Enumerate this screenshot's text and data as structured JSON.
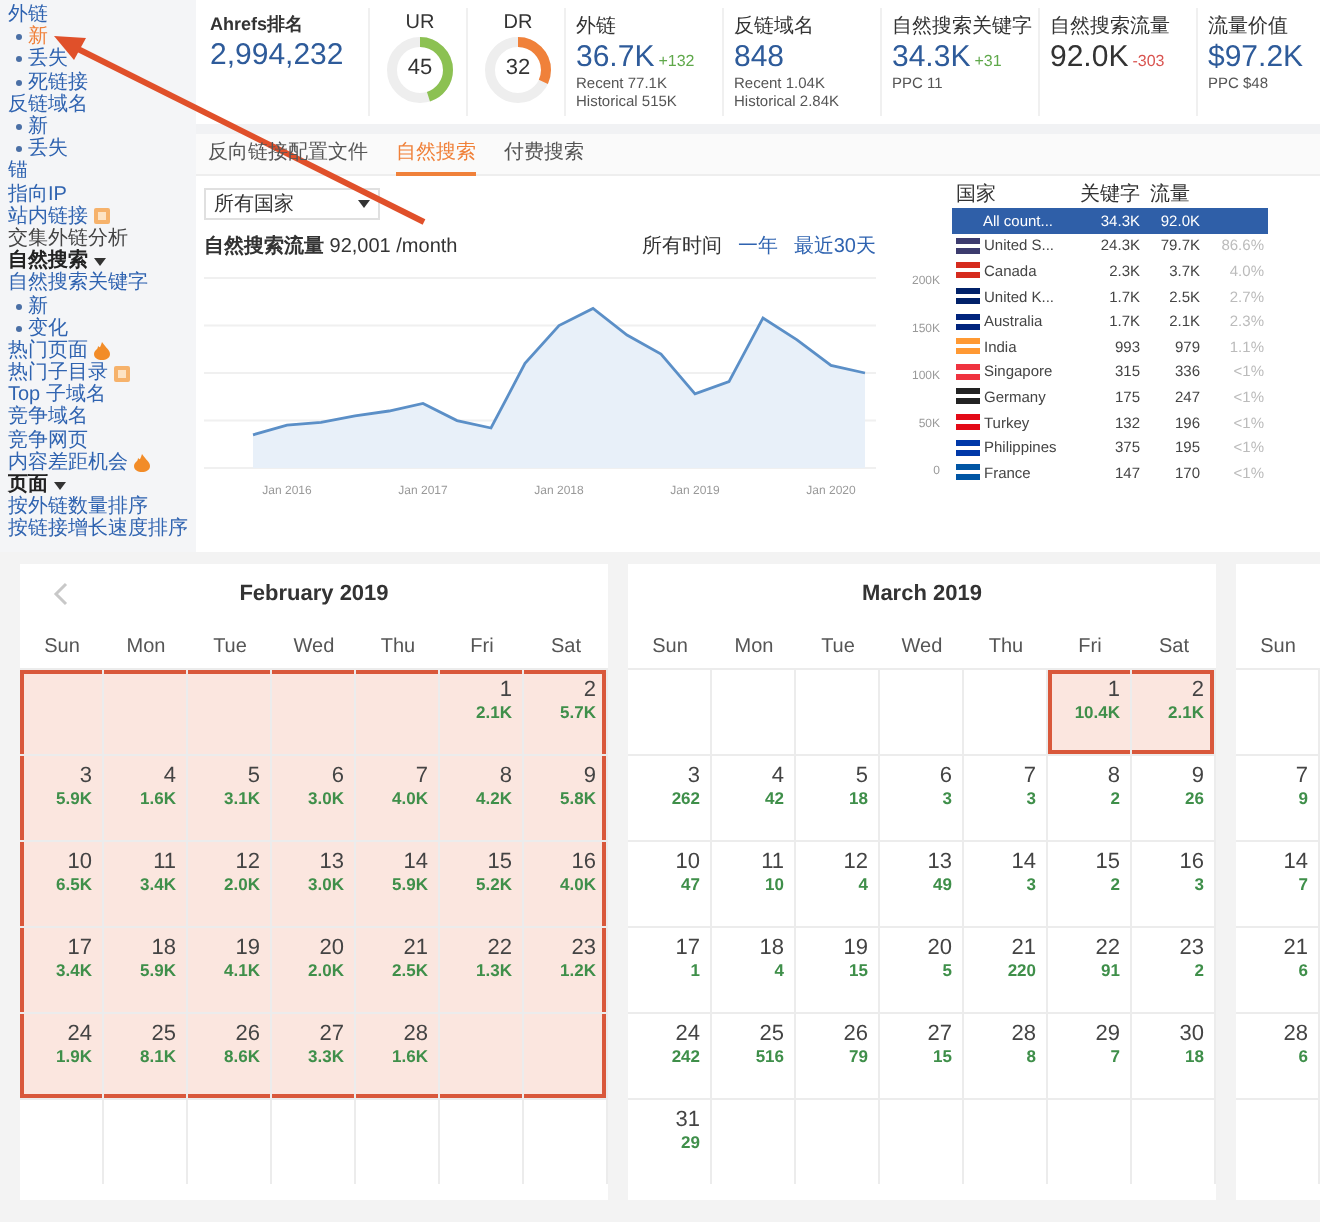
{
  "sidebar": {
    "items": [
      {
        "kind": "link",
        "label": "外链",
        "selected": false
      },
      {
        "kind": "bullet",
        "label": "新",
        "selected": true
      },
      {
        "kind": "bullet",
        "label": "丢失",
        "selected": false
      },
      {
        "kind": "bullet",
        "label": "死链接",
        "selected": false
      },
      {
        "kind": "link",
        "label": "反链域名",
        "selected": false
      },
      {
        "kind": "bullet",
        "label": "新",
        "selected": false
      },
      {
        "kind": "bullet",
        "label": "丢失",
        "selected": false
      },
      {
        "kind": "link",
        "label": "锚",
        "selected": false
      },
      {
        "kind": "link",
        "label": "指向IP",
        "selected": false
      },
      {
        "kind": "link",
        "label": "站内链接",
        "badge": {
          "kind": "new"
        },
        "selected": false
      },
      {
        "kind": "text",
        "label": "交集外链分析",
        "selected": false
      },
      {
        "kind": "heading",
        "label": "自然搜索",
        "selected": false
      },
      {
        "kind": "link",
        "label": "自然搜索关键字",
        "selected": false
      },
      {
        "kind": "bullet",
        "label": "新",
        "selected": false
      },
      {
        "kind": "bullet",
        "label": "变化",
        "selected": false
      },
      {
        "kind": "link",
        "label": "热门页面",
        "badge": {
          "kind": "hot"
        },
        "selected": false
      },
      {
        "kind": "link",
        "label": "热门子目录",
        "badge": {
          "kind": "new"
        },
        "selected": false
      },
      {
        "kind": "link",
        "label": "Top 子域名",
        "selected": false
      },
      {
        "kind": "link",
        "label": "竞争域名",
        "selected": false
      },
      {
        "kind": "link",
        "label": "竞争网页",
        "selected": false
      },
      {
        "kind": "link",
        "label": "内容差距机会",
        "badge": {
          "kind": "hot"
        },
        "selected": false
      },
      {
        "kind": "heading",
        "label": "页面",
        "selected": false
      },
      {
        "kind": "link",
        "label": "按外链数量排序",
        "selected": false
      },
      {
        "kind": "link",
        "label": "按链接增长速度排序",
        "selected": false
      }
    ]
  },
  "metrics": [
    {
      "kind": "number",
      "label": "Ahrefs排名",
      "value": "2,994,232",
      "linked": true
    },
    {
      "kind": "gauge",
      "label": "UR",
      "value": "45",
      "level": 0.45,
      "color": "#8cc152"
    },
    {
      "kind": "gauge",
      "label": "DR",
      "value": "32",
      "level": 0.32,
      "color": "#f0813a"
    },
    {
      "kind": "number",
      "label": "外链",
      "value": "36.7K",
      "delta": "+132",
      "rising": true,
      "linked": true,
      "notes": [
        "Recent 77.1K",
        "Historical 515K"
      ]
    },
    {
      "kind": "number",
      "label": "反链域名",
      "value": "848",
      "linked": true,
      "notes": [
        "Recent 1.04K",
        "Historical 2.84K"
      ]
    },
    {
      "kind": "number",
      "label": "自然搜索关键字",
      "value": "34.3K",
      "delta": "+31",
      "rising": true,
      "linked": true,
      "notes": [
        "PPC 11"
      ]
    },
    {
      "kind": "number",
      "label": "自然搜索流量",
      "value": "92.0K",
      "delta": "-303",
      "rising": false,
      "linked": false
    },
    {
      "kind": "number",
      "label": "流量价值",
      "value": "$97.2K",
      "linked": true,
      "notes": [
        "PPC $48"
      ]
    }
  ],
  "tabs": [
    {
      "label": "反向链接配置文件",
      "selected": false
    },
    {
      "label": "自然搜索",
      "selected": true
    },
    {
      "label": "付费搜索",
      "selected": false
    }
  ],
  "country_select": {
    "value": "所有国家"
  },
  "traffic": {
    "title": "自然搜索流量",
    "value": "92,001 /month",
    "ranges": [
      {
        "label": "所有时间",
        "selected": true
      },
      {
        "label": "一年",
        "selected": false
      },
      {
        "label": "最近30天",
        "selected": false
      }
    ],
    "chart_data": {
      "type": "area",
      "categories": [
        null,
        "Jan 2016",
        null,
        null,
        null,
        "Jan 2017",
        null,
        null,
        null,
        "Jan 2018",
        null,
        null,
        null,
        "Jan 2019",
        null,
        null,
        null,
        "Jan 2020",
        null
      ],
      "series": [
        {
          "color": "#5b8fc7",
          "values": [
            35000,
            45000,
            48000,
            55000,
            60000,
            68000,
            50000,
            42000,
            110000,
            150000,
            168000,
            140000,
            120000,
            78000,
            91000,
            158000,
            135000,
            108000,
            100000
          ]
        }
      ],
      "ylim": [
        0,
        200000
      ],
      "grid": true,
      "yticks": [
        {
          "value": 0,
          "label": "0"
        },
        {
          "value": 50000,
          "label": "50K"
        },
        {
          "value": 100000,
          "label": "100K"
        },
        {
          "value": 150000,
          "label": "150K"
        },
        {
          "value": 200000,
          "label": "200K"
        }
      ]
    }
  },
  "countries": {
    "columns": [
      "国家",
      "关键字",
      "流量"
    ],
    "rows": [
      {
        "name": "All count...",
        "keywords": "34.3K",
        "traffic": "92.0K",
        "selected": true
      },
      {
        "name": "United S...",
        "keywords": "24.3K",
        "traffic": "79.7K",
        "share": "86.6%",
        "color": "#3c3b6e",
        "selected": false
      },
      {
        "name": "Canada",
        "keywords": "2.3K",
        "traffic": "3.7K",
        "share": "4.0%",
        "color": "#d52b1e",
        "selected": false
      },
      {
        "name": "United K...",
        "keywords": "1.7K",
        "traffic": "2.5K",
        "share": "2.7%",
        "color": "#012169",
        "selected": false
      },
      {
        "name": "Australia",
        "keywords": "1.7K",
        "traffic": "2.1K",
        "share": "2.3%",
        "color": "#00247d",
        "selected": false
      },
      {
        "name": "India",
        "keywords": "993",
        "traffic": "979",
        "share": "1.1%",
        "color": "#ff9933",
        "selected": false
      },
      {
        "name": "Singapore",
        "keywords": "315",
        "traffic": "336",
        "share": "<1%",
        "color": "#ef3340",
        "selected": false
      },
      {
        "name": "Germany",
        "keywords": "175",
        "traffic": "247",
        "share": "<1%",
        "color": "#222222",
        "selected": false
      },
      {
        "name": "Turkey",
        "keywords": "132",
        "traffic": "196",
        "share": "<1%",
        "color": "#e30a17",
        "selected": false
      },
      {
        "name": "Philippines",
        "keywords": "375",
        "traffic": "195",
        "share": "<1%",
        "color": "#0038a8",
        "selected": false
      },
      {
        "name": "France",
        "keywords": "147",
        "traffic": "170",
        "share": "<1%",
        "color": "#0055a4",
        "selected": false
      }
    ]
  },
  "calendars": [
    {
      "title": "February 2019",
      "nav": {
        "kind": "prev"
      },
      "weekdays": [
        "Sun",
        "Mon",
        "Tue",
        "Wed",
        "Thu",
        "Fri",
        "Sat"
      ],
      "weeks": [
        [
          {
            "kind": "empty",
            "marked": true
          },
          {
            "kind": "empty",
            "marked": true
          },
          {
            "kind": "empty",
            "marked": true
          },
          {
            "kind": "empty",
            "marked": true
          },
          {
            "kind": "empty",
            "marked": true
          },
          {
            "kind": "day",
            "day": "1",
            "value": "2.1K",
            "marked": true
          },
          {
            "kind": "day",
            "day": "2",
            "value": "5.7K",
            "marked": true
          }
        ],
        [
          {
            "kind": "day",
            "day": "3",
            "value": "5.9K",
            "marked": true
          },
          {
            "kind": "day",
            "day": "4",
            "value": "1.6K",
            "marked": true
          },
          {
            "kind": "day",
            "day": "5",
            "value": "3.1K",
            "marked": true
          },
          {
            "kind": "day",
            "day": "6",
            "value": "3.0K",
            "marked": true
          },
          {
            "kind": "day",
            "day": "7",
            "value": "4.0K",
            "marked": true
          },
          {
            "kind": "day",
            "day": "8",
            "value": "4.2K",
            "marked": true
          },
          {
            "kind": "day",
            "day": "9",
            "value": "5.8K",
            "marked": true
          }
        ],
        [
          {
            "kind": "day",
            "day": "10",
            "value": "6.5K",
            "marked": true
          },
          {
            "kind": "day",
            "day": "11",
            "value": "3.4K",
            "marked": true
          },
          {
            "kind": "day",
            "day": "12",
            "value": "2.0K",
            "marked": true
          },
          {
            "kind": "day",
            "day": "13",
            "value": "3.0K",
            "marked": true
          },
          {
            "kind": "day",
            "day": "14",
            "value": "5.9K",
            "marked": true
          },
          {
            "kind": "day",
            "day": "15",
            "value": "5.2K",
            "marked": true
          },
          {
            "kind": "day",
            "day": "16",
            "value": "4.0K",
            "marked": true
          }
        ],
        [
          {
            "kind": "day",
            "day": "17",
            "value": "3.4K",
            "marked": true
          },
          {
            "kind": "day",
            "day": "18",
            "value": "5.9K",
            "marked": true
          },
          {
            "kind": "day",
            "day": "19",
            "value": "4.1K",
            "marked": true
          },
          {
            "kind": "day",
            "day": "20",
            "value": "2.0K",
            "marked": true
          },
          {
            "kind": "day",
            "day": "21",
            "value": "2.5K",
            "marked": true
          },
          {
            "kind": "day",
            "day": "22",
            "value": "1.3K",
            "marked": true
          },
          {
            "kind": "day",
            "day": "23",
            "value": "1.2K",
            "marked": true
          }
        ],
        [
          {
            "kind": "day",
            "day": "24",
            "value": "1.9K",
            "marked": true
          },
          {
            "kind": "day",
            "day": "25",
            "value": "8.1K",
            "marked": true
          },
          {
            "kind": "day",
            "day": "26",
            "value": "8.6K",
            "marked": true
          },
          {
            "kind": "day",
            "day": "27",
            "value": "3.3K",
            "marked": true
          },
          {
            "kind": "day",
            "day": "28",
            "value": "1.6K",
            "marked": true
          },
          {
            "kind": "empty",
            "marked": true
          },
          {
            "kind": "empty",
            "marked": true
          }
        ],
        [
          {
            "kind": "empty",
            "marked": false
          },
          {
            "kind": "empty",
            "marked": false
          },
          {
            "kind": "empty",
            "marked": false
          },
          {
            "kind": "empty",
            "marked": false
          },
          {
            "kind": "empty",
            "marked": false
          },
          {
            "kind": "empty",
            "marked": false
          },
          {
            "kind": "empty",
            "marked": false
          }
        ]
      ]
    },
    {
      "title": "March 2019",
      "weekdays": [
        "Sun",
        "Mon",
        "Tue",
        "Wed",
        "Thu",
        "Fri",
        "Sat"
      ],
      "weeks": [
        [
          {
            "kind": "empty",
            "marked": false
          },
          {
            "kind": "empty",
            "marked": false
          },
          {
            "kind": "empty",
            "marked": false
          },
          {
            "kind": "empty",
            "marked": false
          },
          {
            "kind": "empty",
            "marked": false
          },
          {
            "kind": "day",
            "day": "1",
            "value": "10.4K",
            "marked": true
          },
          {
            "kind": "day",
            "day": "2",
            "value": "2.1K",
            "marked": true
          }
        ],
        [
          {
            "kind": "day",
            "day": "3",
            "value": "262",
            "marked": false
          },
          {
            "kind": "day",
            "day": "4",
            "value": "42",
            "marked": false
          },
          {
            "kind": "day",
            "day": "5",
            "value": "18",
            "marked": false
          },
          {
            "kind": "day",
            "day": "6",
            "value": "3",
            "marked": false
          },
          {
            "kind": "day",
            "day": "7",
            "value": "3",
            "marked": false
          },
          {
            "kind": "day",
            "day": "8",
            "value": "2",
            "marked": false
          },
          {
            "kind": "day",
            "day": "9",
            "value": "26",
            "marked": false
          }
        ],
        [
          {
            "kind": "day",
            "day": "10",
            "value": "47",
            "marked": false
          },
          {
            "kind": "day",
            "day": "11",
            "value": "10",
            "marked": false
          },
          {
            "kind": "day",
            "day": "12",
            "value": "4",
            "marked": false
          },
          {
            "kind": "day",
            "day": "13",
            "value": "49",
            "marked": false
          },
          {
            "kind": "day",
            "day": "14",
            "value": "3",
            "marked": false
          },
          {
            "kind": "day",
            "day": "15",
            "value": "2",
            "marked": false
          },
          {
            "kind": "day",
            "day": "16",
            "value": "3",
            "marked": false
          }
        ],
        [
          {
            "kind": "day",
            "day": "17",
            "value": "1",
            "marked": false
          },
          {
            "kind": "day",
            "day": "18",
            "value": "4",
            "marked": false
          },
          {
            "kind": "day",
            "day": "19",
            "value": "15",
            "marked": false
          },
          {
            "kind": "day",
            "day": "20",
            "value": "5",
            "marked": false
          },
          {
            "kind": "day",
            "day": "21",
            "value": "220",
            "marked": false
          },
          {
            "kind": "day",
            "day": "22",
            "value": "91",
            "marked": false
          },
          {
            "kind": "day",
            "day": "23",
            "value": "2",
            "marked": false
          }
        ],
        [
          {
            "kind": "day",
            "day": "24",
            "value": "242",
            "marked": false
          },
          {
            "kind": "day",
            "day": "25",
            "value": "516",
            "marked": false
          },
          {
            "kind": "day",
            "day": "26",
            "value": "79",
            "marked": false
          },
          {
            "kind": "day",
            "day": "27",
            "value": "15",
            "marked": false
          },
          {
            "kind": "day",
            "day": "28",
            "value": "8",
            "marked": false
          },
          {
            "kind": "day",
            "day": "29",
            "value": "7",
            "marked": false
          },
          {
            "kind": "day",
            "day": "30",
            "value": "18",
            "marked": false
          }
        ],
        [
          {
            "kind": "day",
            "day": "31",
            "value": "29",
            "marked": false
          },
          {
            "kind": "empty",
            "marked": false
          },
          {
            "kind": "empty",
            "marked": false
          },
          {
            "kind": "empty",
            "marked": false
          },
          {
            "kind": "empty",
            "marked": false
          },
          {
            "kind": "empty",
            "marked": false
          },
          {
            "kind": "empty",
            "marked": false
          }
        ]
      ]
    },
    {
      "weekdays": [
        "Sun"
      ],
      "weeks": [
        [
          {
            "kind": "empty",
            "marked": false
          }
        ],
        [
          {
            "kind": "day",
            "day": "7",
            "value": "9",
            "marked": false
          }
        ],
        [
          {
            "kind": "day",
            "day": "14",
            "value": "7",
            "marked": false
          }
        ],
        [
          {
            "kind": "day",
            "day": "21",
            "value": "6",
            "marked": false
          }
        ],
        [
          {
            "kind": "day",
            "day": "28",
            "value": "6",
            "marked": false
          }
        ],
        [
          {
            "kind": "empty",
            "marked": false
          }
        ]
      ]
    }
  ]
}
